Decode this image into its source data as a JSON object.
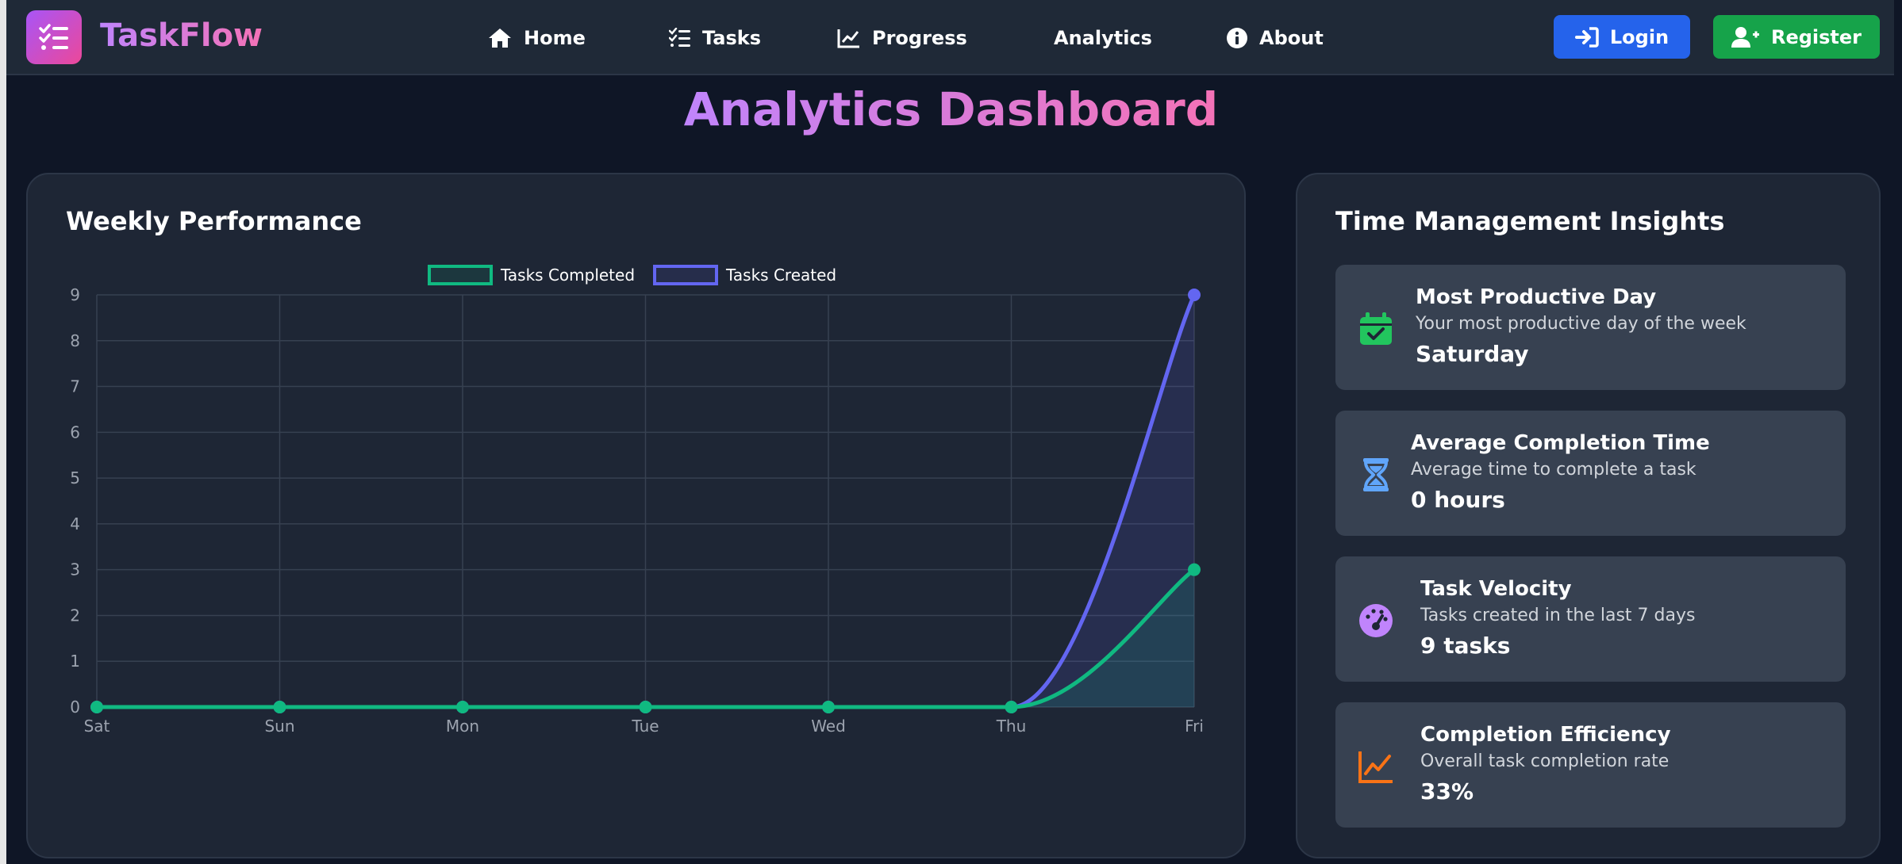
{
  "app": {
    "name": "TaskFlow"
  },
  "nav": {
    "items": [
      {
        "label": "Home",
        "icon": "home-icon"
      },
      {
        "label": "Tasks",
        "icon": "tasks-icon"
      },
      {
        "label": "Progress",
        "icon": "progress-icon"
      },
      {
        "label": "Analytics",
        "icon": ""
      },
      {
        "label": "About",
        "icon": "info-icon"
      }
    ],
    "login_label": "Login",
    "register_label": "Register"
  },
  "page": {
    "title": "Analytics Dashboard"
  },
  "weekly": {
    "title": "Weekly Performance"
  },
  "insights": {
    "title": "Time Management Insights",
    "items": [
      {
        "title": "Most Productive Day",
        "subtitle": "Your most productive day of the week",
        "value": "Saturday",
        "icon": "calendar-check-icon",
        "color": "#22c55e"
      },
      {
        "title": "Average Completion Time",
        "subtitle": "Average time to complete a task",
        "value": "0 hours",
        "icon": "hourglass-icon",
        "color": "#60a5fa"
      },
      {
        "title": "Task Velocity",
        "subtitle": "Tasks created in the last 7 days",
        "value": "9 tasks",
        "icon": "gauge-icon",
        "color": "#c084fc"
      },
      {
        "title": "Completion Efficiency",
        "subtitle": "Overall task completion rate",
        "value": "33%",
        "icon": "chart-line-icon",
        "color": "#f97316"
      }
    ]
  },
  "colors": {
    "completed": "#10b981",
    "created": "#6366f1",
    "brand_gradient_start": "#c084fc",
    "brand_gradient_end": "#f472b6",
    "login": "#2563eb",
    "register": "#16a34a"
  },
  "chart_data": {
    "type": "line",
    "title": "",
    "xlabel": "",
    "ylabel": "",
    "categories": [
      "Sat",
      "Sun",
      "Mon",
      "Tue",
      "Wed",
      "Thu",
      "Fri"
    ],
    "series": [
      {
        "name": "Tasks Completed",
        "values": [
          0,
          0,
          0,
          0,
          0,
          0,
          3
        ],
        "color": "#10b981"
      },
      {
        "name": "Tasks Created",
        "values": [
          0,
          0,
          0,
          0,
          0,
          0,
          9
        ],
        "color": "#6366f1"
      }
    ],
    "ylim": [
      0,
      9
    ],
    "yticks": [
      0,
      1,
      2,
      3,
      4,
      5,
      6,
      7,
      8,
      9
    ],
    "grid": true,
    "legend": "top-center"
  }
}
